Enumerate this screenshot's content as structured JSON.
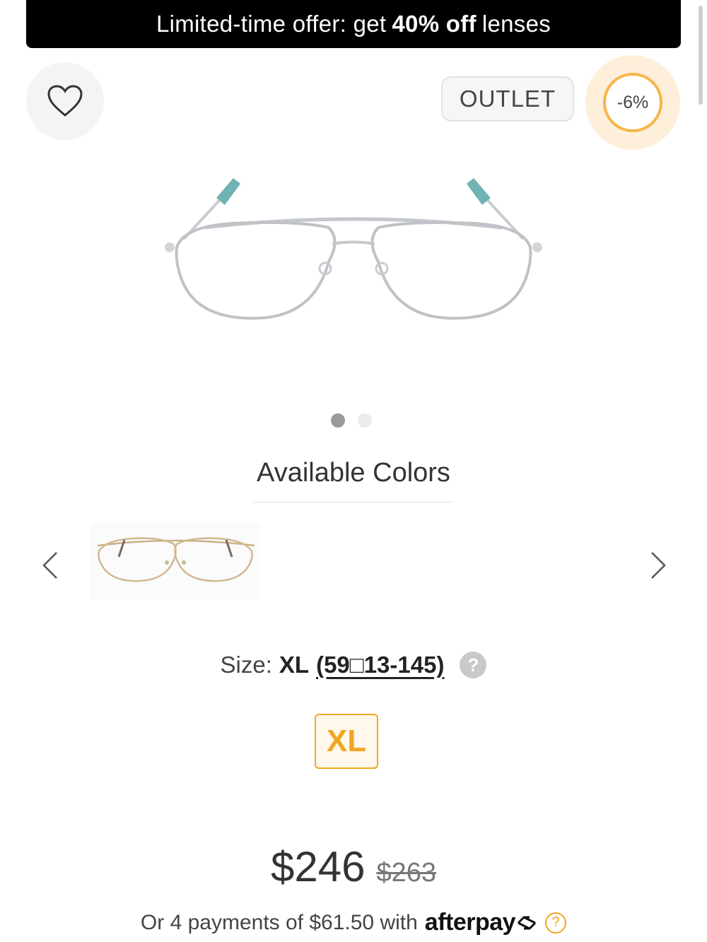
{
  "promo": {
    "text_before": "Limited-time offer: get",
    "highlight": "40% off",
    "text_after": "lenses"
  },
  "badges": {
    "outlet": "OUTLET",
    "discount": "-6%"
  },
  "gallery": {
    "product_image_icon": "aviator-glasses-silver-teal-tips",
    "slide_count": 2,
    "active_slide": 1
  },
  "colors": {
    "title": "Available Colors",
    "swatches": [
      {
        "icon": "aviator-glasses-gold"
      }
    ]
  },
  "size": {
    "label": "Size:",
    "value": "XL",
    "measurement": "(59□13-145)",
    "help_icon": "?",
    "options": [
      {
        "label": "XL",
        "selected": true
      }
    ]
  },
  "price": {
    "current": "$246",
    "original": "$263"
  },
  "afterpay": {
    "text": "Or 4 payments of $61.50 with",
    "logo": "afterpay",
    "help": "?"
  },
  "colors_theme": {
    "accent": "#f0a623",
    "badge_ring": "#f6b54a",
    "badge_bg": "#fdefd9"
  }
}
